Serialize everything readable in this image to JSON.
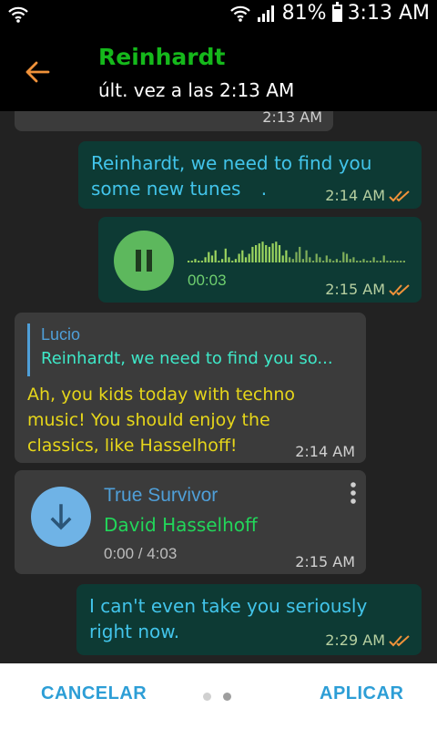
{
  "status_bar": {
    "battery": "81%",
    "battery_level": 0.81,
    "time": "3:13 AM"
  },
  "header": {
    "contact_name": "Reinhardt",
    "last_seen": "últ. vez a las 2:13 AM",
    "accent_color": "#15b81b"
  },
  "messages": {
    "partial_top": {
      "time": "2:13 AM"
    },
    "out1": {
      "text": "Reinhardt, we need to find you some new tunes",
      "dot": ".",
      "time": "2:14 AM"
    },
    "voice": {
      "elapsed": "00:03",
      "time": "2:15 AM"
    },
    "reply": {
      "quoted_author": "Lucio",
      "quoted_text": "Reinhardt, we need to find you so...",
      "text": "Ah, you kids today with techno music! You should enjoy the classics, like Hasselhoff!",
      "time": "2:14 AM"
    },
    "audio": {
      "title": "True Survivor",
      "artist": "David Hasselhoff",
      "progress": "0:00 / 4:03",
      "time": "2:15 AM"
    },
    "out2": {
      "text": "I can't even take you seriously right now.",
      "time": "2:29 AM"
    }
  },
  "bottom_bar": {
    "cancel_label": "CANCELAR",
    "apply_label": "APLICAR",
    "page_count": 2,
    "active_page": 2
  }
}
